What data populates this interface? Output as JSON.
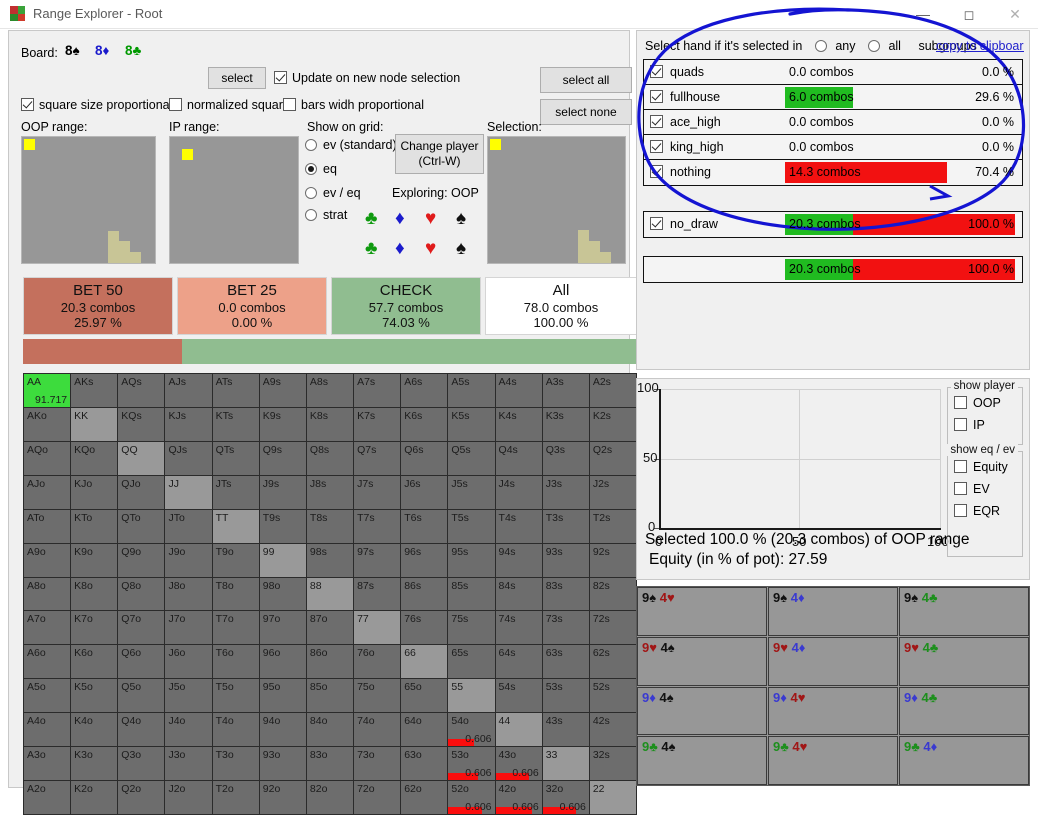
{
  "window": {
    "title": "Range Explorer  - Root",
    "minimize": "—",
    "maximize": "☐",
    "close": "✕"
  },
  "board": {
    "label": "Board:",
    "cards": [
      {
        "rank": "8",
        "suit": "♠",
        "color": "#000000"
      },
      {
        "rank": "8",
        "suit": "♦",
        "color": "#1a1acc"
      },
      {
        "rank": "8",
        "suit": "♣",
        "color": "#009900"
      }
    ]
  },
  "toolbar": {
    "select": "select",
    "select_all": "select all",
    "select_none": "select none",
    "update_on_node": "Update on new node selection",
    "square_size_proportional": "square size proportional",
    "normalized_squares": "normalized squares",
    "bars_width_proportional": "bars widh proportional",
    "update_on_node_checked": true,
    "square_size_checked": true,
    "normalized_checked": false,
    "bars_width_checked": false
  },
  "ranges": {
    "oop_title": "OOP range:",
    "ip_title": "IP range:",
    "selection_title": "Selection:"
  },
  "show_on_grid": {
    "title": "Show on grid:",
    "options": [
      {
        "label": "ev (standard)",
        "selected": false
      },
      {
        "label": "eq",
        "selected": true
      },
      {
        "label": "ev / eq",
        "selected": false
      },
      {
        "label": "strat",
        "selected": false
      }
    ],
    "change_player": "Change player\n(Ctrl-W)",
    "change_player_line1": "Change player",
    "change_player_line2": "(Ctrl-W)",
    "exploring": "Exploring: OOP",
    "suits": [
      "♣",
      "♦",
      "♥",
      "♠"
    ],
    "suit_colors": [
      "#0f9a0f",
      "#1b1bcc",
      "#e01b1b",
      "#111111"
    ]
  },
  "actions": [
    {
      "name": "BET 50",
      "combos": "20.3 combos",
      "pct": "25.97 %",
      "color": "#c4705d"
    },
    {
      "name": "BET 25",
      "combos": "0.0 combos",
      "pct": "0.00 %",
      "color": "#eda189"
    },
    {
      "name": "CHECK",
      "combos": "57.7 combos",
      "pct": "74.03 %",
      "color": "#90bd90"
    },
    {
      "name": "All",
      "combos": "78.0 combos",
      "pct": "100.00 %",
      "color": "#ffffff"
    }
  ],
  "strategy_bar": {
    "red_pct": 25.97,
    "green_pct": 74.03,
    "red_color": "#c4705d",
    "green_color": "#90bd90"
  },
  "matrix": {
    "ranks": [
      "A",
      "K",
      "Q",
      "J",
      "T",
      "9",
      "8",
      "7",
      "6",
      "5",
      "4",
      "3",
      "2"
    ],
    "selected_cells": [
      {
        "hand": "AA",
        "value": "91.717"
      }
    ],
    "valued_cells": [
      {
        "hand": "54o",
        "value": "0.606",
        "bar": 55
      },
      {
        "hand": "53o",
        "value": "0.606",
        "bar": 65
      },
      {
        "hand": "43o",
        "value": "0.606",
        "bar": 72
      },
      {
        "hand": "52o",
        "value": "0.606",
        "bar": 72
      },
      {
        "hand": "42o",
        "value": "0.606",
        "bar": 80
      },
      {
        "hand": "32o",
        "value": "0.606",
        "bar": 72
      }
    ]
  },
  "subgroups": {
    "prefix": "Select hand if it's selected in",
    "any": "any",
    "all": "all",
    "suffix": "subgroups",
    "copy": "copy to clipboard",
    "any_selected": false,
    "all_selected": false,
    "rows": [
      {
        "name": "quads",
        "checked": true,
        "combos": "0.0 combos",
        "pct": "0.0 %",
        "bar_pct": 0,
        "bar_color": "#20bb20"
      },
      {
        "name": "fullhouse",
        "checked": true,
        "combos": "6.0 combos",
        "pct": "29.6 %",
        "bar_pct": 29.6,
        "bar_color": "#20bb20"
      },
      {
        "name": "ace_high",
        "checked": true,
        "combos": "0.0 combos",
        "pct": "0.0 %",
        "bar_pct": 0,
        "bar_color": "#20bb20"
      },
      {
        "name": "king_high",
        "checked": true,
        "combos": "0.0 combos",
        "pct": "0.0 %",
        "bar_pct": 0,
        "bar_color": "#20bb20"
      },
      {
        "name": "nothing",
        "checked": true,
        "combos": "14.3 combos",
        "pct": "70.4 %",
        "bar_pct": 70.4,
        "bar_color": "#f21111"
      }
    ],
    "draw_rows": [
      {
        "name": "no_draw",
        "checked": true,
        "combos": "20.3 combos",
        "pct": "100.0 %",
        "green_pct": 29.6,
        "red_pct": 70.4
      }
    ],
    "total_rows": [
      {
        "name": "",
        "checked": false,
        "combos": "20.3 combos",
        "pct": "100.0 %",
        "green_pct": 29.6,
        "red_pct": 70.4
      }
    ]
  },
  "chart_data": {
    "type": "scatter",
    "title": "",
    "xlabel": "",
    "ylabel": "",
    "xlim": [
      0,
      100
    ],
    "ylim": [
      0,
      100
    ],
    "xticks": [
      "0",
      "50",
      "100"
    ],
    "yticks": [
      "0",
      "50",
      "100"
    ],
    "grid": true,
    "legend_position": "right",
    "series": [],
    "annotations": [
      "Selected 100.0 % (20.3 combos) of OOP range",
      "Equity (in % of pot): 27.59"
    ]
  },
  "chart_controls": {
    "show_player_legend": "show player",
    "show_player": [
      {
        "label": "OOP",
        "checked": false
      },
      {
        "label": "IP",
        "checked": false
      }
    ],
    "show_eq_ev_legend": "show eq / ev",
    "show_eq_ev": [
      {
        "label": "Equity",
        "checked": false
      },
      {
        "label": "EV",
        "checked": false
      },
      {
        "label": "EQR",
        "checked": false
      }
    ]
  },
  "combo_grid": [
    [
      {
        "c1": "9",
        "s1": "♠",
        "k1": "spade",
        "c2": "4",
        "s2": "♥",
        "k2": "heart"
      },
      {
        "c1": "9",
        "s1": "♠",
        "k1": "spade",
        "c2": "4",
        "s2": "♦",
        "k2": "diam"
      },
      {
        "c1": "9",
        "s1": "♠",
        "k1": "spade",
        "c2": "4",
        "s2": "♣",
        "k2": "club"
      }
    ],
    [
      {
        "c1": "9",
        "s1": "♥",
        "k1": "heart",
        "c2": "4",
        "s2": "♠",
        "k2": "spade"
      },
      {
        "c1": "9",
        "s1": "♥",
        "k1": "heart",
        "c2": "4",
        "s2": "♦",
        "k2": "diam"
      },
      {
        "c1": "9",
        "s1": "♥",
        "k1": "heart",
        "c2": "4",
        "s2": "♣",
        "k2": "club"
      }
    ],
    [
      {
        "c1": "9",
        "s1": "♦",
        "k1": "diam",
        "c2": "4",
        "s2": "♠",
        "k2": "spade"
      },
      {
        "c1": "9",
        "s1": "♦",
        "k1": "diam",
        "c2": "4",
        "s2": "♥",
        "k2": "heart"
      },
      {
        "c1": "9",
        "s1": "♦",
        "k1": "diam",
        "c2": "4",
        "s2": "♣",
        "k2": "club"
      }
    ],
    [
      {
        "c1": "9",
        "s1": "♣",
        "k1": "club",
        "c2": "4",
        "s2": "♠",
        "k2": "spade"
      },
      {
        "c1": "9",
        "s1": "♣",
        "k1": "club",
        "c2": "4",
        "s2": "♥",
        "k2": "heart"
      },
      {
        "c1": "9",
        "s1": "♣",
        "k1": "club",
        "c2": "4",
        "s2": "♦",
        "k2": "diam"
      }
    ]
  ],
  "annotation": {
    "color": "#1414d2",
    "shape": "hand-drawn-ellipse"
  }
}
